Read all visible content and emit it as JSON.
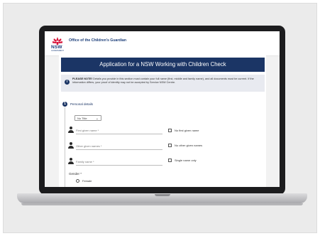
{
  "header": {
    "logo_text": "NSW",
    "logo_subtext": "GOVERNMENT",
    "org_name": "Office of the Children's Guardian"
  },
  "form": {
    "banner_title": "Application for a NSW Working with Children Check",
    "note": {
      "label": "PLEASE NOTE!",
      "text": "Details you provide in this section must contain your full name (first, middle and family name), and all documents must be current. If the information differs, your proof of identity may not be accepted by Service NSW Centre."
    },
    "section": {
      "number": "1",
      "title": "Personal details"
    },
    "title_select": {
      "value": "No Title"
    },
    "fields": [
      {
        "placeholder": "First given name *",
        "checkbox_label": "No first given name"
      },
      {
        "placeholder": "Other given names *",
        "checkbox_label": "No other given names"
      },
      {
        "placeholder": "Family name *",
        "checkbox_label": "Single name only"
      }
    ],
    "gender": {
      "label": "Gender *",
      "options": [
        "Female"
      ]
    }
  }
}
